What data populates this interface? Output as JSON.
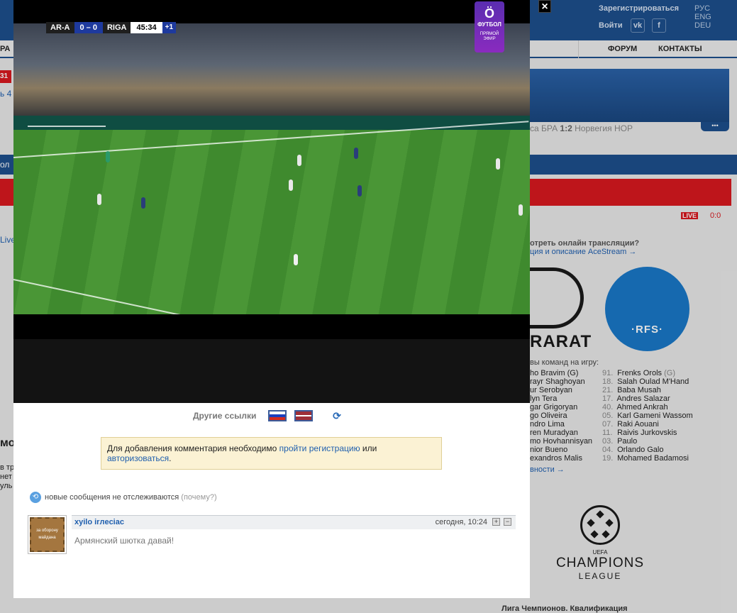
{
  "background_site": {
    "header": {
      "register": "Зарегистрироваться",
      "login": "Войти",
      "social": [
        "vk-icon",
        "facebook-icon"
      ],
      "social_labels": [
        "vk",
        "f"
      ],
      "languages": [
        "РУС",
        "ENG",
        "DEU"
      ]
    },
    "nav": {
      "forum": "ФОРУМ",
      "contacts": "КОНТАКТЫ",
      "left_fragment": "РА"
    },
    "left_fragments": [
      "31",
      "ь 4",
      "ол",
      "Live",
      "мо",
      "в тр",
      "нет",
      "уль"
    ],
    "ticker": {
      "text": "са БРА ",
      "score": "1:2",
      "rest": " Норвегия НОР",
      "more": "•••"
    },
    "live": {
      "badge": "LIVE",
      "score": "0:0"
    },
    "acestream": {
      "title": "отреть онлайн трансляции?",
      "link": "ция и описание AceStream →"
    },
    "teams": {
      "home_logo_text": "RARAT",
      "away_logo_text": "·RFS·"
    },
    "squads": {
      "title": "вы команд на игру:",
      "home": [
        "ho Bravim (G)",
        "rayr Shaghoyan",
        "ur Serobyan",
        "lyn Tera",
        "gar Grigoryan",
        "go Oliveira",
        "ndro Lima",
        "ren Muradyan",
        "mo Hovhannisyan",
        "nior Bueno",
        "exandros Malis"
      ],
      "away": [
        {
          "num": "91.",
          "name": "Frenks Orols",
          "pos": "(G)"
        },
        {
          "num": "18.",
          "name": "Salah Oulad M'Hand",
          "pos": ""
        },
        {
          "num": "21.",
          "name": "Baba Musah",
          "pos": ""
        },
        {
          "num": "17.",
          "name": "Andres Salazar",
          "pos": ""
        },
        {
          "num": "40.",
          "name": "Ahmed Ankrah",
          "pos": ""
        },
        {
          "num": "05.",
          "name": "Karl Gameni Wassom",
          "pos": ""
        },
        {
          "num": "07.",
          "name": "Raki Aouani",
          "pos": ""
        },
        {
          "num": "11.",
          "name": "Raivis Jurkovskis",
          "pos": ""
        },
        {
          "num": "03.",
          "name": "Paulo",
          "pos": ""
        },
        {
          "num": "04.",
          "name": "Orlando Galo",
          "pos": ""
        },
        {
          "num": "19.",
          "name": "Mohamed Badamosi",
          "pos": ""
        }
      ],
      "news_link": "вности →"
    },
    "champions": {
      "uefa": "UEFA",
      "champions": "CHAMPIONS",
      "league": "LEAGUE"
    },
    "footer_title": "Лига Чемпионов. Квалификация"
  },
  "modal": {
    "close_label": "×",
    "video": {
      "home_team": "AR-A",
      "score": "0 – 0",
      "away_team": "RIGA",
      "time": "45:34",
      "added_time": "+1",
      "channel_logo": "Ö",
      "channel_name": "ФУТБОЛ",
      "channel_live": "ПРЯМОЙ ЭФИР"
    },
    "links": {
      "label": "Другие ссылки",
      "flags": [
        "russia-flag",
        "latvia-flag"
      ],
      "refresh_icon": "refresh-icon"
    },
    "notice": {
      "text_before": "Для добавления комментария необходимо ",
      "register_link": "пройти регистрацию",
      "text_middle": " или ",
      "login_link": "авторизоваться",
      "text_after": "."
    },
    "tracking": {
      "text": "новые сообщения не отслеживаются",
      "why": "(почему?)"
    },
    "comment": {
      "author": "xyilo irлeciac",
      "time": "сегодня, 10:24",
      "body": "Армянский шютка давай!",
      "avatar_text": "за оборону майдана",
      "plus": "+",
      "minus": "−"
    }
  }
}
